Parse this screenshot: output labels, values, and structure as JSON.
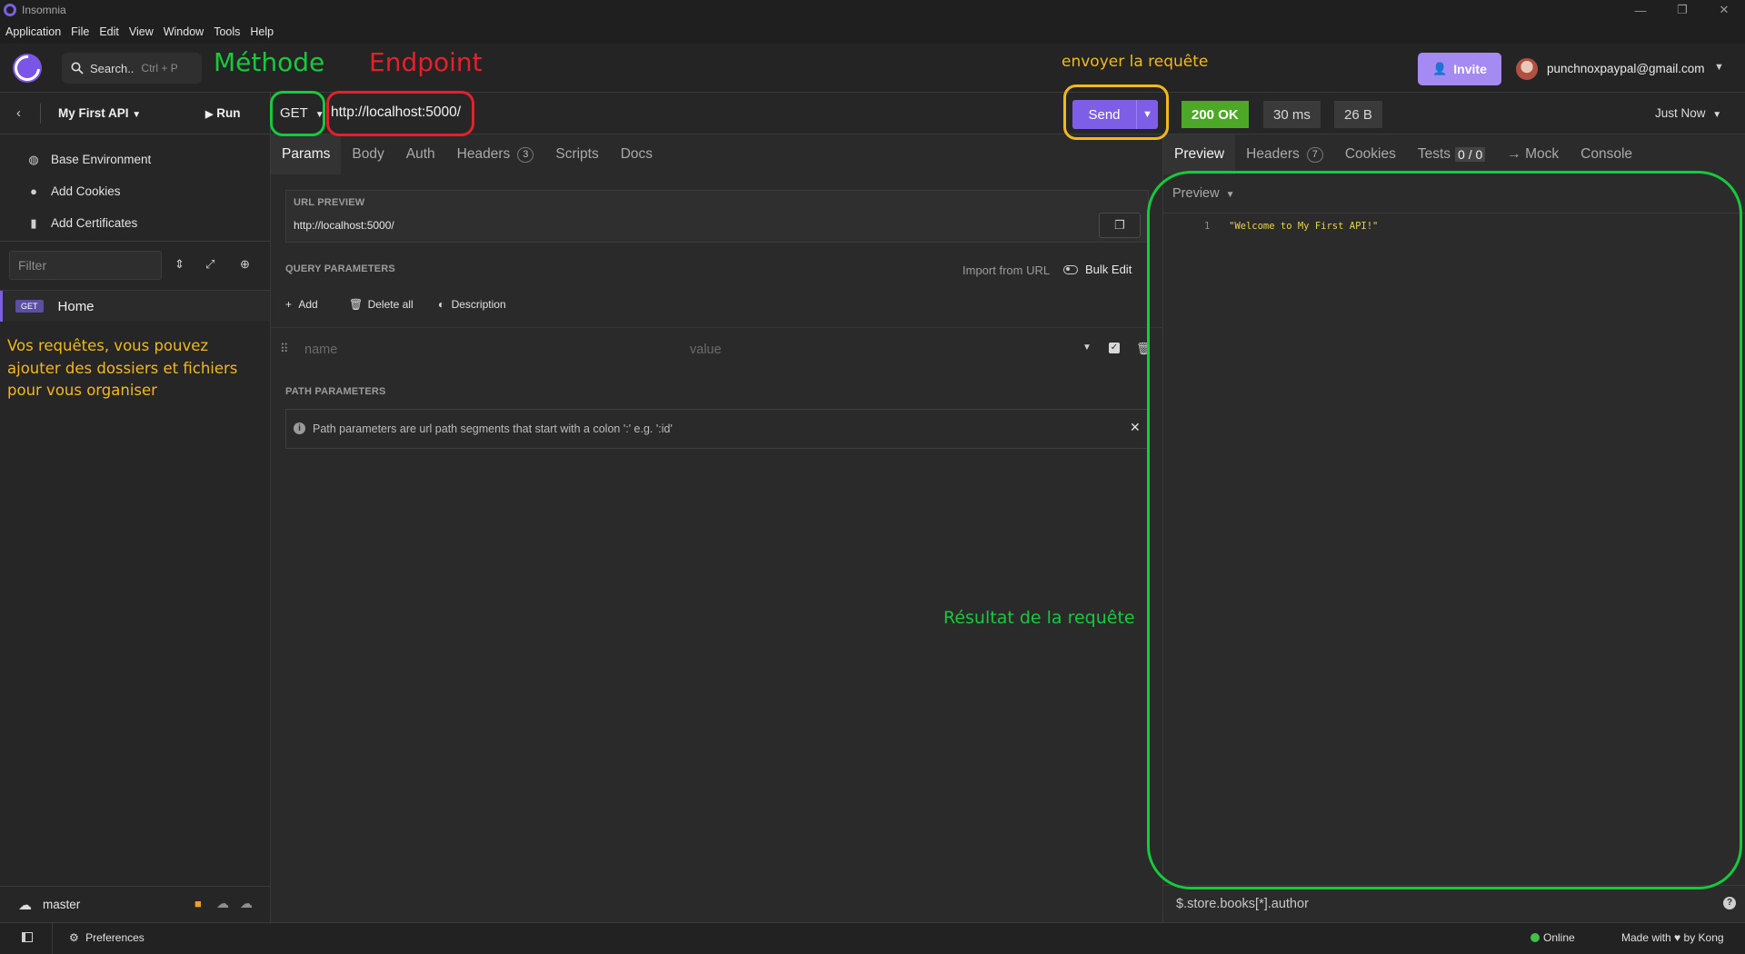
{
  "window": {
    "title": "Insomnia",
    "controls": [
      "—",
      "❐",
      "✕"
    ]
  },
  "menu": [
    "Application",
    "File",
    "Edit",
    "View",
    "Window",
    "Tools",
    "Help"
  ],
  "header": {
    "search_label": "Search..",
    "search_shortcut": "Ctrl + P",
    "invite_label": "Invite",
    "account_email": "punchnoxpaypal@gmail.com"
  },
  "annotations": {
    "method": "Méthode",
    "endpoint": "Endpoint",
    "send": "envoyer la requête",
    "sidebar_note_lines": [
      "Vos requêtes, vous pouvez",
      "ajouter des dossiers et fichiers",
      "pour vous organiser"
    ],
    "result": "Résultat de la requête",
    "colors": {
      "green": "#17c93c",
      "red": "#e4212b",
      "yellow": "#f3b81e"
    }
  },
  "sidebar": {
    "project": "My First API",
    "run_label": "Run",
    "env_items": [
      {
        "label": "Base Environment",
        "icon": "globe-icon"
      },
      {
        "label": "Add Cookies",
        "icon": "cookie-icon"
      },
      {
        "label": "Add Certificates",
        "icon": "certificate-icon"
      }
    ],
    "filter_placeholder": "Filter",
    "requests": [
      {
        "method": "GET",
        "name": "Home"
      }
    ],
    "branch": "master"
  },
  "request": {
    "method": "GET",
    "url": "http://localhost:5000/",
    "send_label": "Send",
    "tabs": [
      {
        "label": "Params",
        "active": true
      },
      {
        "label": "Body"
      },
      {
        "label": "Auth"
      },
      {
        "label": "Headers",
        "count": "3"
      },
      {
        "label": "Scripts"
      },
      {
        "label": "Docs"
      }
    ],
    "url_preview_label": "URL PREVIEW",
    "url_preview_value": "http://localhost:5000/",
    "query_params_label": "QUERY PARAMETERS",
    "import_from_url": "Import from URL",
    "bulk_edit": "Bulk Edit",
    "add_label": "Add",
    "delete_all_label": "Delete all",
    "description_label": "Description",
    "param_name_placeholder": "name",
    "param_value_placeholder": "value",
    "path_params_label": "PATH PARAMETERS",
    "path_params_info": "Path parameters are url path segments that start with a colon ':' e.g. ':id'"
  },
  "response": {
    "status": "200 OK",
    "time": "30 ms",
    "size": "26 B",
    "when": "Just Now",
    "tabs": [
      {
        "label": "Preview",
        "active": true
      },
      {
        "label": "Headers",
        "count": "7"
      },
      {
        "label": "Cookies"
      },
      {
        "label": "Tests",
        "count": "0 / 0"
      },
      {
        "label": "→ Mock"
      },
      {
        "label": "Console"
      }
    ],
    "preview_mode": "Preview",
    "line_number": "1",
    "body": "\"Welcome to My First API!\"",
    "jsonpath_placeholder": "$.store.books[*].author"
  },
  "footer": {
    "preferences": "Preferences",
    "online": "Online",
    "made_with": "Made with",
    "by_kong": "by Kong"
  }
}
